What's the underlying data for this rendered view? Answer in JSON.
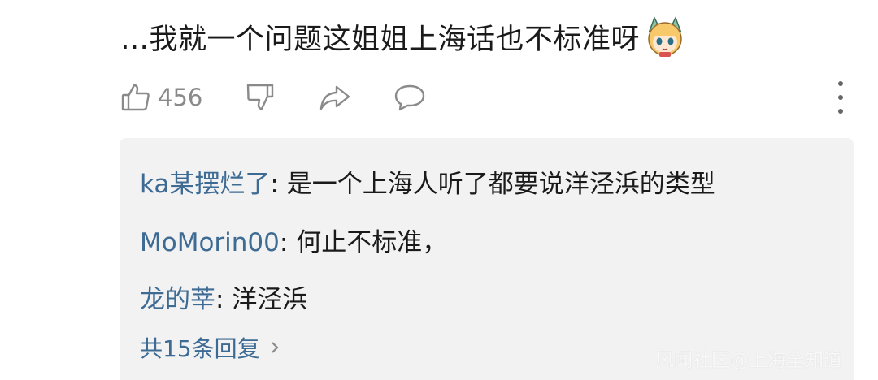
{
  "comment": {
    "text": "…我就一个问题这姐姐上海话也不标准呀",
    "sticker_icon": "anime-girl-sticker"
  },
  "actions": {
    "like_count": "456",
    "like_icon": "thumbs-up-icon",
    "dislike_icon": "thumbs-down-icon",
    "share_icon": "share-arrow-icon",
    "comment_icon": "comment-bubble-icon",
    "more_icon": "more-vertical-icon"
  },
  "replies": [
    {
      "user": "ka某摆烂了",
      "sep": ": ",
      "text": "是一个上海人听了都要说洋泾浜的类型"
    },
    {
      "user": "MoMorin00",
      "sep": ": ",
      "text": "何止不标准，"
    },
    {
      "user": "龙的莘",
      "sep": ": ",
      "text": "洋泾浜"
    }
  ],
  "more_replies_label": "共15条回复",
  "watermark": "风闻社区@上海全知道",
  "colors": {
    "link_blue": "#3d6b94",
    "icon_gray": "#8a8a8a",
    "reply_bg": "#f2f2f2",
    "text": "#1a1a1a"
  }
}
